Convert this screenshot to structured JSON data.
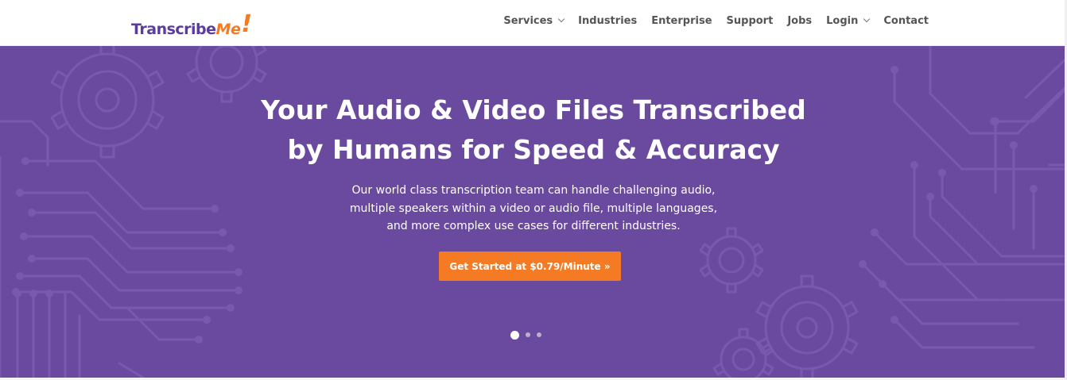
{
  "logo": {
    "word1": "Transcribe",
    "word2": "Me",
    "bang": "!"
  },
  "nav": {
    "items": [
      {
        "label": "Services",
        "dropdown": true
      },
      {
        "label": "Industries",
        "dropdown": false
      },
      {
        "label": "Enterprise",
        "dropdown": false
      },
      {
        "label": "Support",
        "dropdown": false
      },
      {
        "label": "Jobs",
        "dropdown": false
      },
      {
        "label": "Login",
        "dropdown": true
      },
      {
        "label": "Contact",
        "dropdown": false
      }
    ]
  },
  "hero": {
    "title_line1": "Your Audio & Video Files Transcribed",
    "title_line2": "by Humans for Speed & Accuracy",
    "subtitle_line1": "Our world class transcription team can handle challenging audio,",
    "subtitle_line2": "multiple speakers within a video or audio file, multiple languages,",
    "subtitle_line3": "and more complex use cases for different industries.",
    "cta_label": "Get Started at $0.79/Minute »",
    "slides_count": 3,
    "active_slide": 1
  },
  "colors": {
    "brand_purple": "#6a4a9f",
    "logo_purple": "#5b3c9e",
    "accent_orange": "#f47b24",
    "nav_text": "#555555"
  },
  "icons": [
    "chevron-down-icon",
    "gear-icon",
    "circuit-pattern"
  ]
}
